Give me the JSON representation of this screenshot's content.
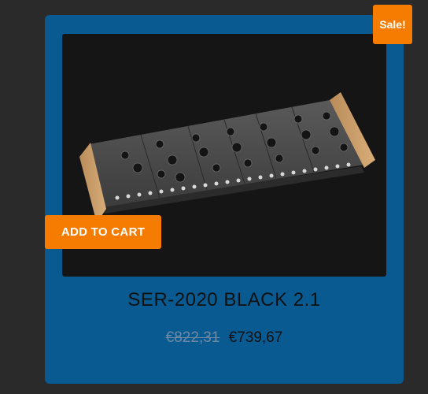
{
  "product": {
    "sale_badge": "Sale!",
    "add_to_cart_label": "ADD TO CART",
    "title": "SER-2020 BLACK 2.1",
    "old_price": "€822,31",
    "new_price": "€739,67",
    "image_alt": "synthesizer-product-image"
  },
  "colors": {
    "page_background": "#2a2a2a",
    "card_background": "#0a5a92",
    "accent": "#f57c00"
  }
}
